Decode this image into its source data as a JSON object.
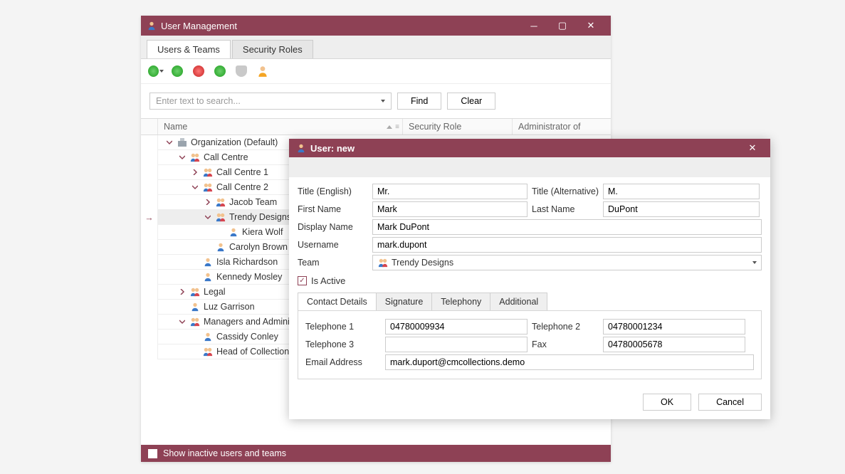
{
  "main": {
    "title": "User Management",
    "tabs": [
      "Users & Teams",
      "Security Roles"
    ],
    "search_placeholder": "Enter text to search...",
    "find_label": "Find",
    "clear_label": "Clear",
    "columns": {
      "name": "Name",
      "security": "Security Role",
      "admin": "Administrator of"
    },
    "footer_checkbox": "Show inactive users and teams"
  },
  "tree": {
    "rows": [
      {
        "indent": 0,
        "expander": "down",
        "icon": "org",
        "text": "Organization (Default)"
      },
      {
        "indent": 1,
        "expander": "down",
        "icon": "team",
        "text": "Call Centre"
      },
      {
        "indent": 2,
        "expander": "right",
        "icon": "team",
        "text": "Call Centre 1"
      },
      {
        "indent": 2,
        "expander": "down",
        "icon": "team",
        "text": "Call Centre 2"
      },
      {
        "indent": 3,
        "expander": "right",
        "icon": "team",
        "text": "Jacob Team"
      },
      {
        "indent": 3,
        "expander": "down",
        "icon": "team",
        "text": "Trendy Designs",
        "selected": true,
        "arrow": true
      },
      {
        "indent": 4,
        "expander": "",
        "icon": "user",
        "text": "Kiera Wolf"
      },
      {
        "indent": 3,
        "expander": "",
        "icon": "user",
        "text": "Carolyn Brown"
      },
      {
        "indent": 2,
        "expander": "",
        "icon": "user",
        "text": "Isla Richardson"
      },
      {
        "indent": 2,
        "expander": "",
        "icon": "user",
        "text": "Kennedy Mosley"
      },
      {
        "indent": 1,
        "expander": "right",
        "icon": "team",
        "text": "Legal"
      },
      {
        "indent": 1,
        "expander": "",
        "icon": "user",
        "text": "Luz Garrison"
      },
      {
        "indent": 1,
        "expander": "down",
        "icon": "team",
        "text": "Managers and Administrat"
      },
      {
        "indent": 2,
        "expander": "",
        "icon": "user",
        "text": "Cassidy Conley"
      },
      {
        "indent": 2,
        "expander": "",
        "icon": "team",
        "text": "Head of Collections"
      }
    ]
  },
  "dialog": {
    "title": "User: new",
    "labels": {
      "title_en": "Title (English)",
      "title_alt": "Title (Alternative)",
      "first_name": "First Name",
      "last_name": "Last Name",
      "display_name": "Display Name",
      "username": "Username",
      "team": "Team",
      "is_active": "Is Active",
      "telephone1": "Telephone 1",
      "telephone2": "Telephone 2",
      "telephone3": "Telephone 3",
      "fax": "Fax",
      "email": "Email Address"
    },
    "values": {
      "title_en": "Mr.",
      "title_alt": "M.",
      "first_name": "Mark",
      "last_name": "DuPont",
      "display_name": "Mark DuPont",
      "username": "mark.dupont",
      "team": "Trendy Designs",
      "is_active": true,
      "telephone1": "04780009934",
      "telephone2": "04780001234",
      "telephone3": "",
      "fax": "04780005678",
      "email": "mark.duport@cmcollections.demo"
    },
    "sub_tabs": [
      "Contact Details",
      "Signature",
      "Telephony",
      "Additional"
    ],
    "ok_label": "OK",
    "cancel_label": "Cancel"
  }
}
